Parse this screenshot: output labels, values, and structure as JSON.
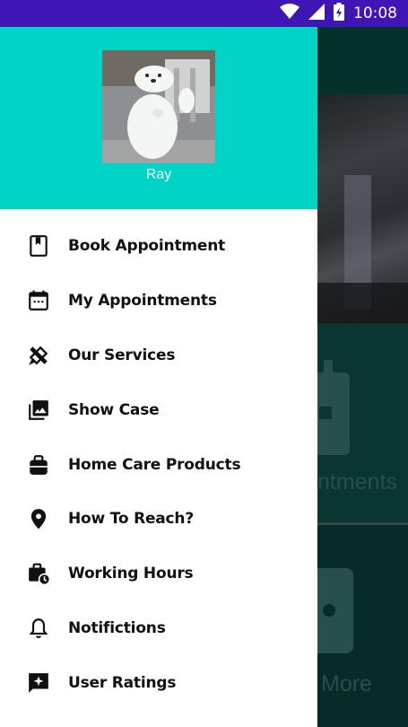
{
  "status_bar": {
    "time": "10:08",
    "icons": [
      "wifi-icon",
      "signal-icon",
      "battery-charging-icon"
    ],
    "background": "#3f15b6"
  },
  "drawer": {
    "header_color": "#00d4c6",
    "user_name": "Ray",
    "items": [
      {
        "label": "Book Appointment",
        "icon": "bookmark-icon"
      },
      {
        "label": "My Appointments",
        "icon": "calendar-icon"
      },
      {
        "label": "Our Services",
        "icon": "tools-icon"
      },
      {
        "label": "Show Case",
        "icon": "photo-library-icon"
      },
      {
        "label": "Home Care Products",
        "icon": "bag-icon"
      },
      {
        "label": "How To Reach?",
        "icon": "location-pin-icon"
      },
      {
        "label": "Working Hours",
        "icon": "work-clock-icon"
      },
      {
        "label": "Notifictions",
        "icon": "bell-icon"
      },
      {
        "label": "User Ratings",
        "icon": "rate-review-icon"
      }
    ]
  },
  "background": {
    "card_label_1": "ntments",
    "card_label_2": "More"
  }
}
